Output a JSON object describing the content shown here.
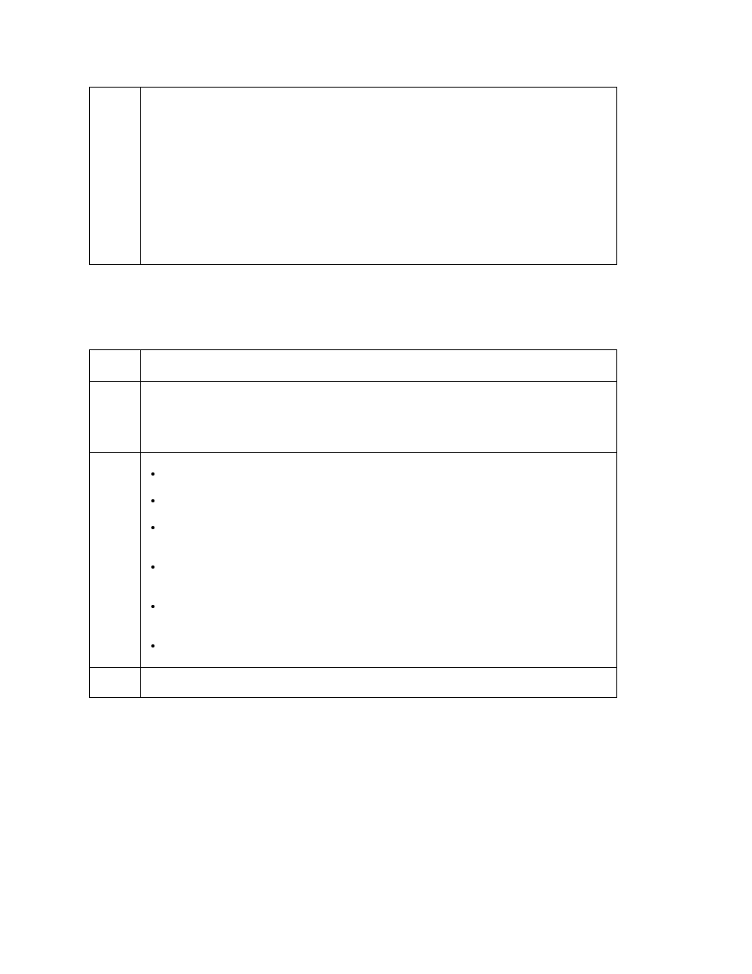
{
  "table1": {
    "left": "",
    "right": ""
  },
  "table2": {
    "rows": [
      {
        "left": "",
        "right": ""
      },
      {
        "left": "",
        "right": ""
      },
      {
        "left": "",
        "bullets": [
          "",
          "",
          "",
          "",
          "",
          ""
        ]
      },
      {
        "left": "",
        "right": ""
      }
    ]
  }
}
